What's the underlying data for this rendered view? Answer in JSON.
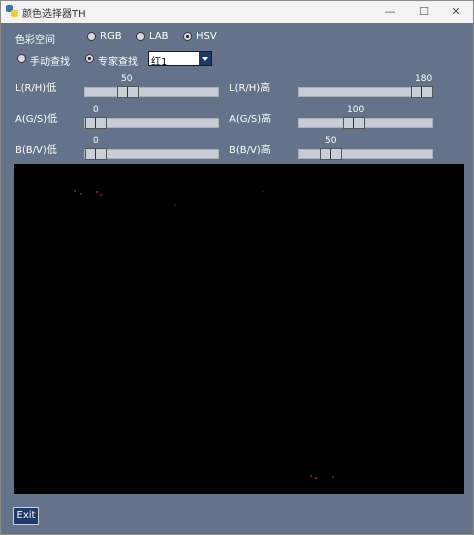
{
  "window": {
    "title": "颜色选择器TH",
    "controls": {
      "minimize": "—",
      "maximize": "☐",
      "close": "✕"
    }
  },
  "color_space": {
    "label": "色彩空间",
    "options": [
      {
        "label": "RGB",
        "selected": false
      },
      {
        "label": "LAB",
        "selected": false
      },
      {
        "label": "HSV",
        "selected": true
      }
    ]
  },
  "mode": {
    "options": [
      {
        "label": "手动查找",
        "selected": false
      },
      {
        "label": "专家查找",
        "selected": true
      }
    ],
    "preset": {
      "value": "红1"
    }
  },
  "sliders": [
    {
      "label": "L(R/H)低",
      "value": "50"
    },
    {
      "label": "L(R/H)高",
      "value": "180"
    },
    {
      "label": "A(G/S)低",
      "value": "0"
    },
    {
      "label": "A(G/S)高",
      "value": "100"
    },
    {
      "label": "B(B/V)低",
      "value": "0"
    },
    {
      "label": "B(B/V)高",
      "value": "50"
    }
  ],
  "exit_label": "Exit",
  "colors": {
    "background": "#64738a",
    "accent": "#1f3a68",
    "preview_bg": "#000000"
  }
}
